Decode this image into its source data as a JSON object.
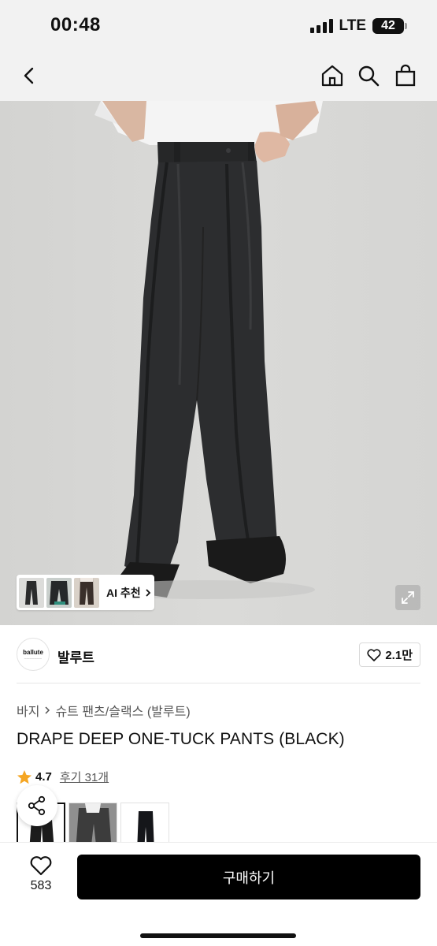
{
  "status_bar": {
    "time": "00:48",
    "network": "LTE",
    "battery": "42"
  },
  "nav": {
    "back_icon": "chevron-left-icon",
    "home_icon": "home-icon",
    "search_icon": "search-icon",
    "cart_icon": "shopping-bag-icon"
  },
  "gallery": {
    "ai_label": "AI 추천",
    "expand_icon": "expand-icon"
  },
  "brand": {
    "logo_text": "ballute",
    "name": "발루트",
    "likes": "2.1만"
  },
  "breadcrumb": {
    "category": "바지",
    "subcategory": "슈트 팬츠/슬랙스 (발루트)"
  },
  "product": {
    "title": "DRAPE DEEP ONE-TUCK PANTS (BLACK)",
    "rating": "4.7",
    "reviews": "후기 31개"
  },
  "bottom_bar": {
    "wish_count": "583",
    "buy_label": "구매하기"
  },
  "colors": {
    "accent": "#f5a623",
    "buy_button": "#000000",
    "hero_background": "#d8d8d6"
  }
}
